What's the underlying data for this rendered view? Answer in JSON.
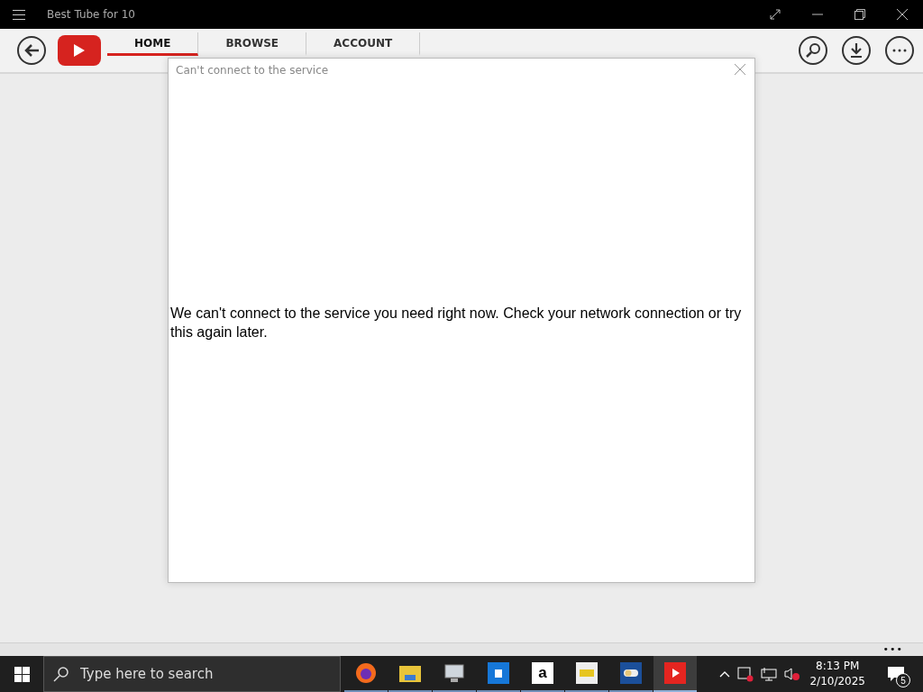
{
  "window": {
    "title": "Best Tube for 10"
  },
  "nav": {
    "tabs": [
      {
        "label": "HOME",
        "selected": true
      },
      {
        "label": "BROWSE",
        "selected": false
      },
      {
        "label": "ACCOUNT",
        "selected": false
      }
    ]
  },
  "dialog": {
    "title": "Can't connect to the service",
    "message": "We can't connect to the service you need right now. Check your network connection or try this again later."
  },
  "more_label": "•••",
  "taskbar": {
    "search": {
      "placeholder": "Type here to search"
    },
    "apps": [
      {
        "kind": "firefox",
        "active": false
      },
      {
        "kind": "folder",
        "active": false
      },
      {
        "kind": "computer",
        "active": false
      },
      {
        "kind": "bluebag",
        "active": false
      },
      {
        "kind": "amazon",
        "label": "a",
        "active": false
      },
      {
        "kind": "tag",
        "active": false
      },
      {
        "kind": "toggle",
        "active": false
      },
      {
        "kind": "tube",
        "active": true
      }
    ],
    "time": "8:13 PM",
    "date": "2/10/2025",
    "notifications": "5"
  }
}
